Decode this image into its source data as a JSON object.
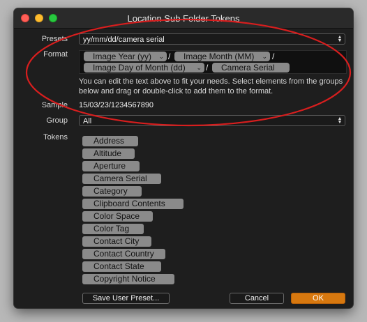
{
  "window": {
    "title": "Location Sub Folder Tokens"
  },
  "presets": {
    "label": "Presets",
    "value": "yy/mm/dd/camera serial"
  },
  "format": {
    "label": "Format",
    "tokens": [
      "Image Year (yy)",
      "Image Month (MM)",
      "Image Day of Month (dd)",
      "Camera Serial"
    ],
    "separator": "/"
  },
  "help_text": "You can edit the text above to fit your needs. Select elements from the groups below and drag or double-click to add them to the format.",
  "sample": {
    "label": "Sample",
    "value": "15/03/23/1234567890"
  },
  "group": {
    "label": "Group",
    "value": "All"
  },
  "tokens": {
    "label": "Tokens",
    "items": [
      "Address",
      "Altitude",
      "Aperture",
      "Camera Serial",
      "Category",
      "Clipboard Contents",
      "Color Space",
      "Color Tag",
      "Contact City",
      "Contact Country",
      "Contact State",
      "Copyright Notice"
    ]
  },
  "buttons": {
    "save_preset": "Save User Preset...",
    "cancel": "Cancel",
    "ok": "OK"
  },
  "colors": {
    "accent": "#d7780f",
    "annotation": "#d81e1e",
    "token_bg": "#8a8a8a"
  },
  "icons": {
    "stepper": "up-down-chevron-icon",
    "token_menu": "chevron-down-icon"
  }
}
